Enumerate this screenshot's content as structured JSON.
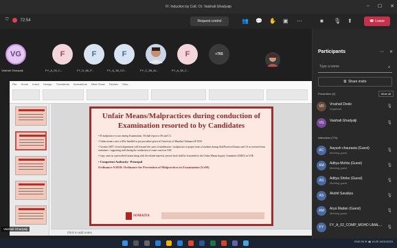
{
  "window": {
    "title": "FI: Induction by CoE: Dr. Vaishali Ghadyalp"
  },
  "meeting": {
    "timer": "72:54",
    "request_control": "Request control",
    "leave": "Leave"
  },
  "participants_strip": [
    {
      "initials": "VG",
      "label": "Vaishali Ghadyalji",
      "color": "#e3c9f0",
      "fg": "#6b3a8a"
    },
    {
      "initials": "F",
      "label": "FY_A_09_C...",
      "color": "#f3d5dc",
      "fg": "#9a4a5e"
    },
    {
      "initials": "F",
      "label": "FY_D_66_P...",
      "color": "#d8e4f2",
      "fg": "#4a6a8a"
    },
    {
      "initials": "F",
      "label": "FY_A_38_CO...",
      "color": "#d8e4f2",
      "fg": "#4a6a8a"
    },
    {
      "initials": "",
      "label": "FY_C_58_AL...",
      "color": "#b08860",
      "fg": "#fff"
    },
    {
      "initials": "F",
      "label": "FY_A_38_C...",
      "color": "#f3d5dc",
      "fg": "#9a4a5e"
    },
    {
      "initials": "+765",
      "label": "",
      "color": "#3a3a3a",
      "fg": "#eee"
    }
  ],
  "panel": {
    "title": "Participants",
    "search_placeholder": "Type a name",
    "share_invite": "Share invite",
    "presenters_header": "Presenters (2)",
    "mute_all": "Mute all",
    "attendees_header": "Attendees (770)",
    "presenters": [
      {
        "initials": "VD",
        "name": "Vrushali Desle",
        "role": "Organizer",
        "color": "#6a4a3a"
      },
      {
        "initials": "VG",
        "name": "Vaishali Ghadyalji",
        "role": "",
        "color": "#7a4a9a"
      }
    ],
    "attendees": [
      {
        "initials": "AC",
        "name": "Aayush chaurasia (Guest)",
        "role": "Meeting guest",
        "color": "#4a6aa0"
      },
      {
        "initials": "AM",
        "name": "Aditya Mehta (Guest)",
        "role": "Meeting guest",
        "color": "#4a6aa0"
      },
      {
        "initials": "AS",
        "name": "Aditya Shirke (Guest)",
        "role": "Meeting guest",
        "color": "#4a6aa0"
      },
      {
        "initials": "AS",
        "name": "Akshit Savaliya",
        "role": "",
        "color": "#4a6aa0"
      },
      {
        "initials": "AM",
        "name": "Arya Madan (Guest)",
        "role": "Meeting guest",
        "color": "#4a6aa0"
      },
      {
        "initials": "FY",
        "name": "FY_A_02_COMP_MOHD UMAL...",
        "role": "",
        "color": "#4a6aa0"
      }
    ]
  },
  "slide": {
    "title": "Unfair Means/Malpractices during conduction of Examination resorted to by Candidates",
    "bullets": [
      "• 05 malpractice occurs during Examination, 50 shall report to SS and CC.",
      "• Unfair means cases will be handled as per procedure given in University of Mumbai Ordinance R 9258.",
      "• Circular 18/07 of each department will forward the cases of misbehavior / malpractice to proper form of students during Oral/Practical Exams and CA as received from examiners / supporting staff during the conduction of exam course in CSE.",
      "• Copy cases in a prescribed format along with the related material, answer book shall be forwarded to the Unfair Means Inquiry Committee (UMIC) in COE."
    ],
    "authority": "• Competent Authority- Principal",
    "ordinance": "Ordinance 0.5050: Ordinance for Prevention of Malpractices in Examination (UoM)",
    "logo_text": "SOMAIYA"
  },
  "ppt": {
    "notes_placeholder": "Click to add notes",
    "tabs": [
      "File",
      "Home",
      "Insert",
      "Design",
      "Transitions",
      "Animations",
      "Slide Show",
      "Review",
      "View"
    ]
  },
  "presenter_tag": "Vaishali Ghadyalji",
  "taskbar": {
    "lang": "ENG",
    "region": "IN",
    "time": "14:29",
    "date": "16/11/2023"
  }
}
